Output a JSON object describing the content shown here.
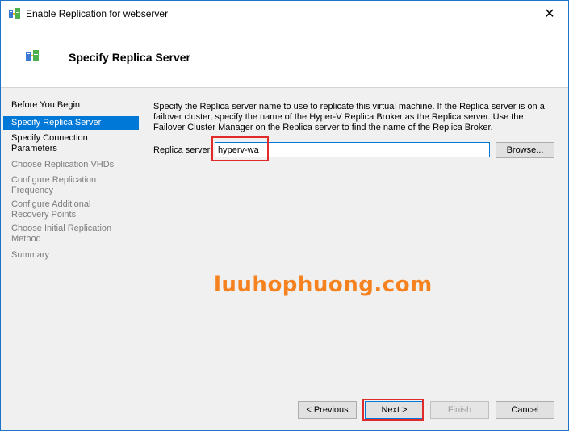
{
  "window": {
    "title": "Enable Replication for webserver",
    "close_glyph": "✕",
    "icon": "hyper-v-replication-icon"
  },
  "header": {
    "title": "Specify Replica Server",
    "icon": "replica-server-icon"
  },
  "nav": {
    "items": [
      {
        "label": "Before You Begin",
        "state": "done"
      },
      {
        "label": "Specify Replica Server",
        "state": "active"
      },
      {
        "label": "Specify Connection\nParameters",
        "state": "done"
      },
      {
        "label": "Choose Replication VHDs",
        "state": "pending"
      },
      {
        "label": "Configure Replication\nFrequency",
        "state": "pending"
      },
      {
        "label": "Configure Additional\nRecovery Points",
        "state": "pending"
      },
      {
        "label": "Choose Initial Replication\nMethod",
        "state": "pending"
      },
      {
        "label": "Summary",
        "state": "pending"
      }
    ]
  },
  "content": {
    "description": "Specify the Replica server name to use to replicate this virtual machine. If the Replica server is on a failover cluster, specify the name of the Hyper-V Replica Broker as the Replica server. Use the Failover Cluster Manager on the Replica server to find the name of the Replica Broker.",
    "replica_label": "Replica server:",
    "replica_value": "hyperv-wa",
    "browse_label": "Browse..."
  },
  "footer": {
    "previous_label": "< Previous",
    "next_label": "Next >",
    "finish_label": "Finish",
    "cancel_label": "Cancel"
  },
  "watermark": "luuhophuong.com",
  "colors": {
    "accent": "#0078d7",
    "highlight": "#e02b2b",
    "watermark": "#f5821f"
  }
}
